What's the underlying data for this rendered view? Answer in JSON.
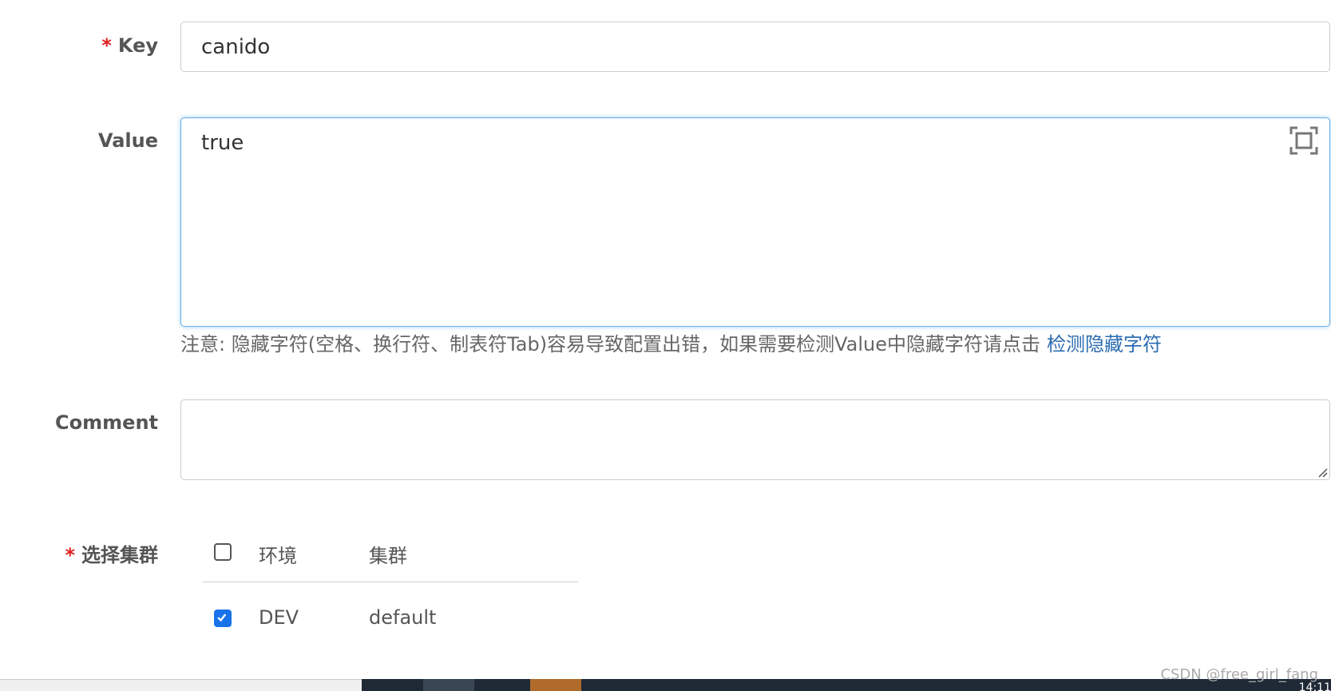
{
  "form": {
    "key": {
      "label": "Key",
      "required_mark": "*",
      "value": "canido"
    },
    "value": {
      "label": "Value",
      "text": "true",
      "expand_icon": "fullscreen-icon"
    },
    "note": {
      "text": "注意: 隐藏字符(空格、换行符、制表符Tab)容易导致配置出错，如果需要检测Value中隐藏字符请点击",
      "link": "检测隐藏字符"
    },
    "comment": {
      "label": "Comment",
      "text": ""
    },
    "cluster": {
      "label": "选择集群",
      "required_mark": "*",
      "headers": {
        "env": "环境",
        "cluster": "集群"
      },
      "rows": [
        {
          "env": "DEV",
          "cluster": "default",
          "checked": true
        }
      ]
    }
  },
  "footer": {
    "watermark": "CSDN @free_girl_fang",
    "clock": "14:11"
  },
  "colors": {
    "accent": "#1a73e8",
    "link": "#2b6cb0",
    "required": "#e02020",
    "focus_border": "#66afe9"
  }
}
